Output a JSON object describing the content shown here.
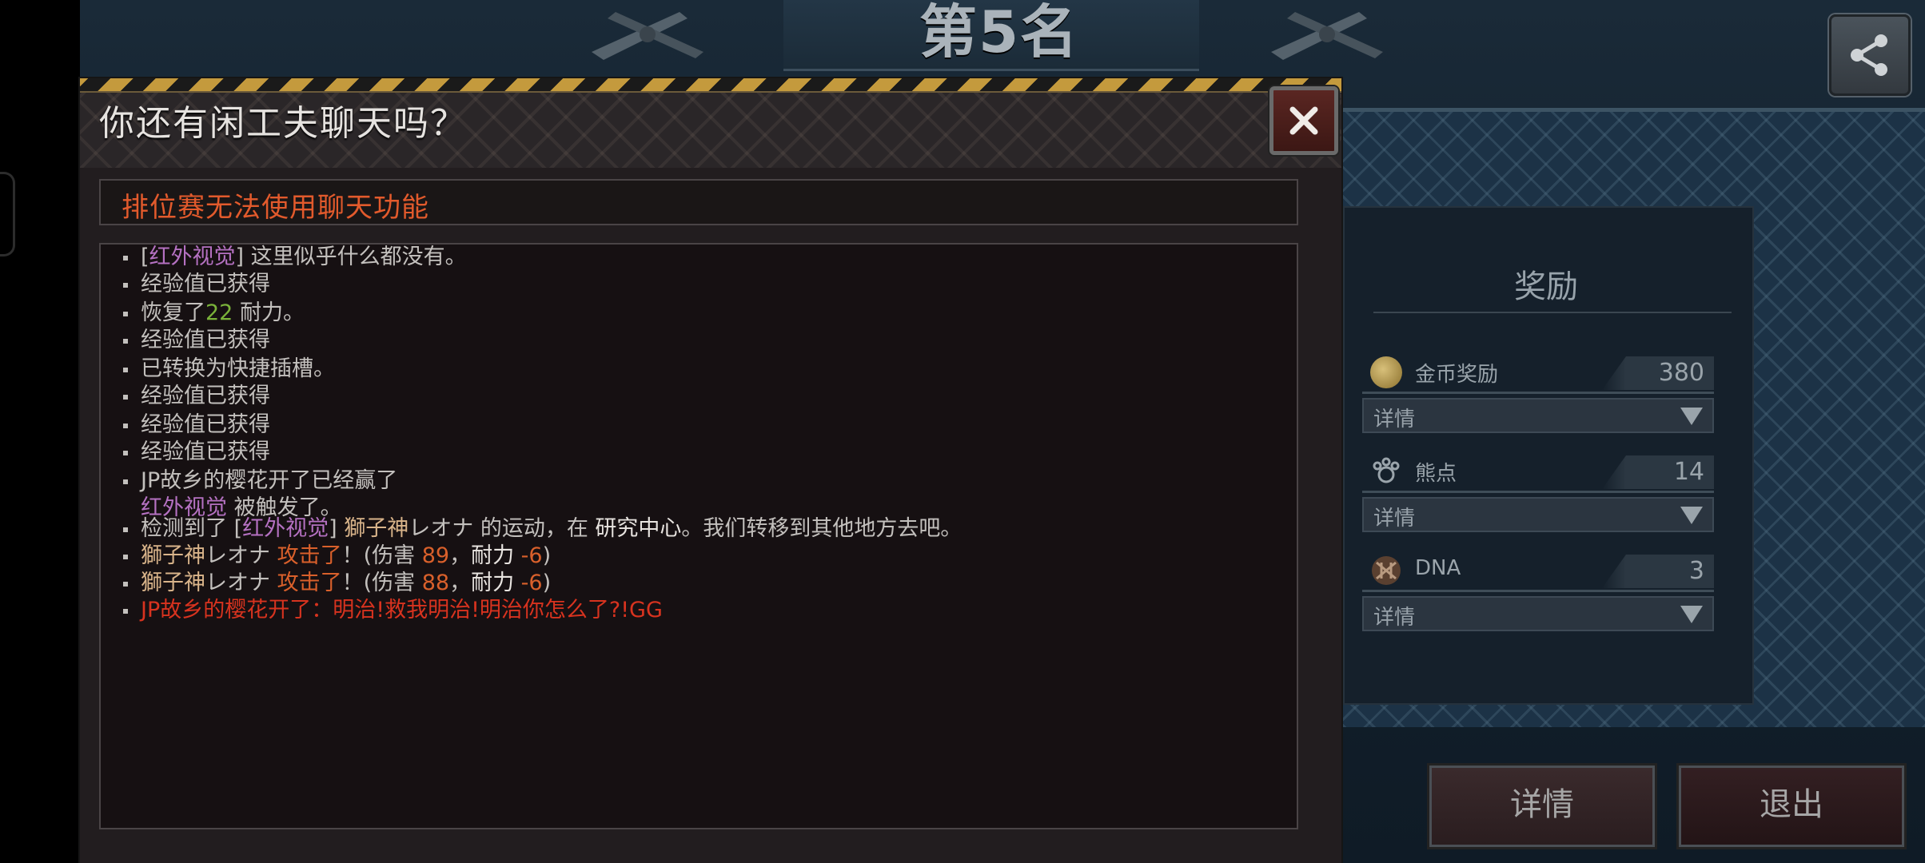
{
  "rank_title": "第5名",
  "dialog": {
    "title": "你还有闲工夫聊天吗？",
    "notice": "排位赛无法使用聊天功能",
    "log": [
      {
        "parts": [
          {
            "t": "[",
            "c": ""
          },
          {
            "t": "红外视觉",
            "c": "purple"
          },
          {
            "t": "] 这里似乎什么都没有。",
            "c": ""
          }
        ]
      },
      {
        "parts": [
          {
            "t": "经验值已获得",
            "c": ""
          }
        ]
      },
      {
        "parts": [
          {
            "t": "恢复了",
            "c": ""
          },
          {
            "t": "22",
            "c": "green"
          },
          {
            "t": " 耐力。",
            "c": ""
          }
        ]
      },
      {
        "parts": [
          {
            "t": "经验值已获得",
            "c": ""
          }
        ]
      },
      {
        "parts": [
          {
            "t": "已转换为快捷插槽。",
            "c": ""
          }
        ]
      },
      {
        "parts": [
          {
            "t": "经验值已获得",
            "c": ""
          }
        ]
      },
      {
        "parts": [
          {
            "t": "经验值已获得",
            "c": ""
          }
        ]
      },
      {
        "parts": [
          {
            "t": "经验值已获得",
            "c": ""
          }
        ]
      },
      {
        "parts": [
          {
            "t": "JP故乡的樱花开了已经赢了",
            "c": ""
          }
        ]
      },
      {
        "parts": [
          {
            "t": "红外视觉",
            "c": "purple"
          },
          {
            "t": " 被触发了。",
            "c": ""
          }
        ]
      },
      {
        "parts": [
          {
            "t": "检测到了 [",
            "c": ""
          },
          {
            "t": "红外视觉",
            "c": "purple"
          },
          {
            "t": "] ",
            "c": ""
          },
          {
            "t": "獅子神",
            "c": "name"
          },
          {
            "t": "レオナ",
            "c": ""
          },
          {
            "t": " 的运动，在 ",
            "c": ""
          },
          {
            "t": "研究中心",
            "c": "white"
          },
          {
            "t": "。我们转移到其他地方去吧。",
            "c": ""
          }
        ]
      },
      {
        "parts": [
          {
            "t": "獅子神",
            "c": "name"
          },
          {
            "t": "レオナ  ",
            "c": ""
          },
          {
            "t": "攻击了",
            "c": "orange"
          },
          {
            "t": "！(伤害 ",
            "c": ""
          },
          {
            "t": "89",
            "c": "orange"
          },
          {
            "t": "，",
            "c": ""
          },
          {
            "t": "耐力",
            "c": "white"
          },
          {
            "t": "  ",
            "c": ""
          },
          {
            "t": "-6",
            "c": "orange"
          },
          {
            "t": ")",
            "c": ""
          }
        ]
      },
      {
        "parts": [
          {
            "t": "獅子神",
            "c": "name"
          },
          {
            "t": "レオナ  ",
            "c": ""
          },
          {
            "t": "攻击了",
            "c": "orange"
          },
          {
            "t": "！(伤害 ",
            "c": ""
          },
          {
            "t": "88",
            "c": "orange"
          },
          {
            "t": "，",
            "c": ""
          },
          {
            "t": "耐力",
            "c": "white"
          },
          {
            "t": "  ",
            "c": ""
          },
          {
            "t": "-6",
            "c": "orange"
          },
          {
            "t": ")",
            "c": ""
          }
        ]
      },
      {
        "parts": [
          {
            "t": "JP故乡的樱花开了：明治!救我明治!明治你怎么了?!GG",
            "c": "red"
          }
        ]
      }
    ]
  },
  "rewards": {
    "title": "奖励",
    "items": [
      {
        "label": "金币奖励",
        "value": "380",
        "icon": "coin-icon",
        "detail": "详情"
      },
      {
        "label": "熊点",
        "value": "14",
        "icon": "bear-paw-icon",
        "detail": "详情"
      },
      {
        "label": "DNA",
        "value": "3",
        "icon": "dna-icon",
        "detail": "详情"
      }
    ]
  },
  "buttons": {
    "details": "详情",
    "exit": "退出"
  },
  "colors": {
    "purple": "#b571c2",
    "green": "#7ab23a",
    "orange": "#d9602b",
    "red": "#d8331f",
    "notice": "#e25a2c"
  }
}
